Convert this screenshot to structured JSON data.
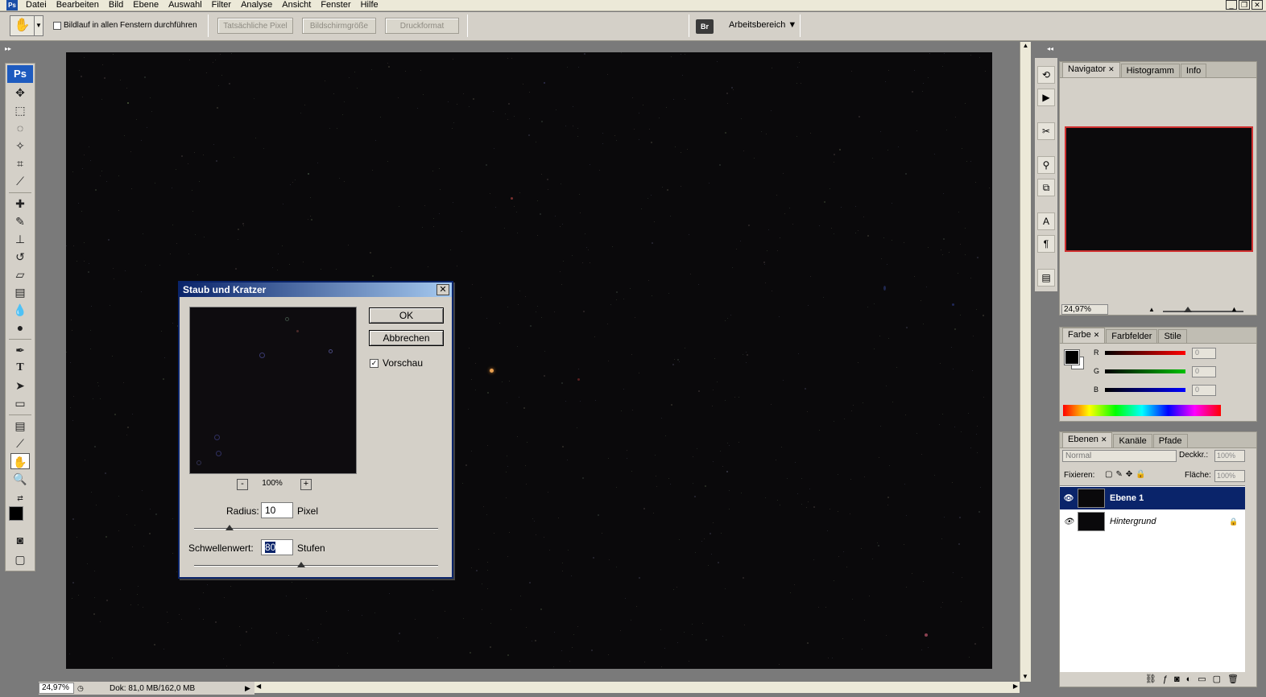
{
  "menubar": {
    "logo": "Ps",
    "items": [
      "Datei",
      "Bearbeiten",
      "Bild",
      "Ebene",
      "Auswahl",
      "Filter",
      "Analyse",
      "Ansicht",
      "Fenster",
      "Hilfe"
    ],
    "window_buttons": [
      "_",
      "❐",
      "✕"
    ]
  },
  "options": {
    "scroll_all_label": "Bildlauf in allen Fenstern durchführen",
    "actual_pixels": "Tatsächliche Pixel",
    "fit_screen": "Bildschirmgröße",
    "print_size": "Druckformat",
    "workspace": "Arbeitsbereich ▼",
    "bridge_label": "Br"
  },
  "toolbar": {
    "logo": "Ps"
  },
  "status": {
    "zoom": "24,97%",
    "doc": "Dok: 81,0 MB/162,0 MB"
  },
  "navigator": {
    "tabs": [
      "Navigator",
      "Histogramm",
      "Info"
    ],
    "zoom": "24,97%"
  },
  "color": {
    "tabs": [
      "Farbe",
      "Farbfelder",
      "Stile"
    ],
    "channels": [
      {
        "label": "R",
        "value": "0",
        "color": "#ff0000"
      },
      {
        "label": "G",
        "value": "0",
        "color": "#00c000"
      },
      {
        "label": "B",
        "value": "0",
        "color": "#0000ff"
      }
    ]
  },
  "layers": {
    "tabs": [
      "Ebenen",
      "Kanäle",
      "Pfade"
    ],
    "blend_mode": "Normal",
    "opacity_label": "Deckkr.:",
    "opacity": "100%",
    "lock_label": "Fixieren:",
    "fill_label": "Fläche:",
    "fill": "100%",
    "items": [
      {
        "name": "Ebene 1",
        "selected": true
      },
      {
        "name": "Hintergrund",
        "selected": false
      }
    ]
  },
  "dialog": {
    "title": "Staub und Kratzer",
    "ok": "OK",
    "cancel": "Abbrechen",
    "preview_label": "Vorschau",
    "preview_checked": true,
    "zoom": "100%",
    "zoom_out": "-",
    "zoom_in": "+",
    "radius_label": "Radius:",
    "radius_value": "10",
    "radius_unit": "Pixel",
    "threshold_label": "Schwellenwert:",
    "threshold_value": "80",
    "threshold_unit": "Stufen",
    "close": "✕"
  }
}
